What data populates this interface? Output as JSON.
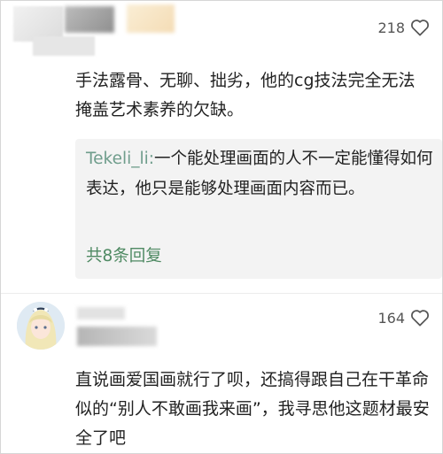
{
  "comments": [
    {
      "likes": "218",
      "text": "手法露骨、无聊、拙劣，他的cg技法完全无法掩盖艺术素养的欠缺。",
      "reply": {
        "author": "Tekeli_li:",
        "text": "一个能处理画面的人不一定能懂得如何表达，他只是能够处理画面内容而已。",
        "more_label": "共8条回复"
      }
    },
    {
      "likes": "164",
      "text": "直说画爱国画就行了呗，还搞得跟自己在干革命似的“别人不敢画我来画”，我寻思他这题材最安全了吧"
    }
  ],
  "icons": {
    "like": "heart-outline-icon"
  },
  "colors": {
    "reply_author": "#6f9d8c",
    "reply_more": "#4f8a63",
    "reply_background": "#f3f3f3",
    "text": "#222222",
    "meta": "#555555"
  }
}
